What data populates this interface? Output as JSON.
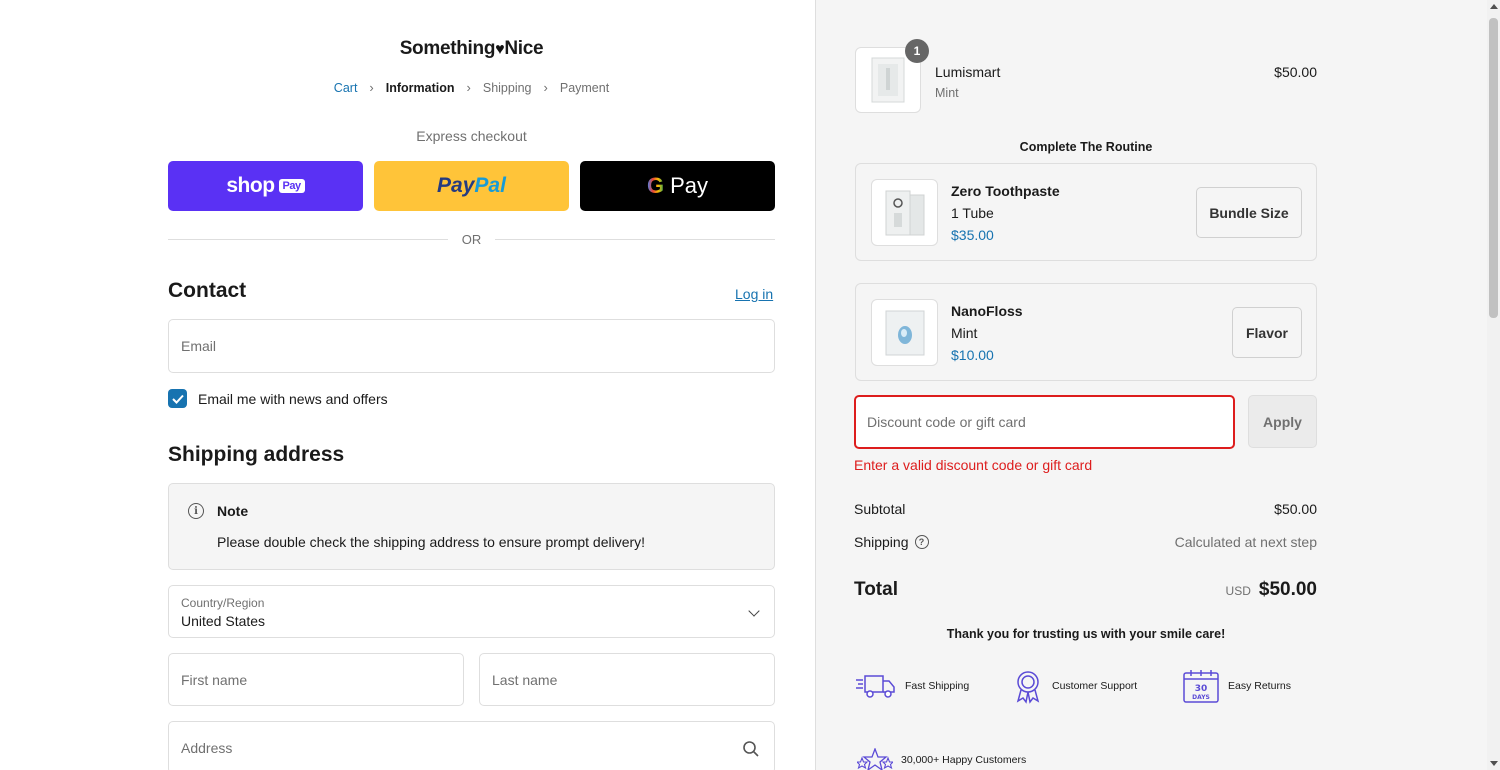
{
  "store": {
    "name_left": "Something",
    "name_right": "Nice"
  },
  "breadcrumb": {
    "cart": "Cart",
    "information": "Information",
    "shipping": "Shipping",
    "payment": "Payment"
  },
  "express": {
    "label": "Express checkout",
    "shop_pay": "shop",
    "shop_pay_tag": "Pay",
    "paypal_a": "Pay",
    "paypal_b": "Pal",
    "gpay_g": "G",
    "gpay_text": "Pay",
    "or": "OR"
  },
  "contact": {
    "title": "Contact",
    "login": "Log in",
    "email_placeholder": "Email",
    "newsletter_label": "Email me with news and offers",
    "newsletter_checked": true
  },
  "shipping_address": {
    "title": "Shipping address",
    "note_title": "Note",
    "note_text": "Please double check the shipping address to ensure prompt delivery!",
    "country_label": "Country/Region",
    "country_value": "United States",
    "first_name_placeholder": "First name",
    "last_name_placeholder": "Last name",
    "address_placeholder": "Address"
  },
  "cart_item": {
    "quantity": "1",
    "name": "Lumismart",
    "variant": "Mint",
    "price": "$50.00"
  },
  "routine": {
    "title": "Complete The Routine",
    "items": [
      {
        "name": "Zero Toothpaste",
        "variant": "1 Tube",
        "price": "$35.00",
        "button": "Bundle Size"
      },
      {
        "name": "NanoFloss",
        "variant": "Mint",
        "price": "$10.00",
        "button": "Flavor"
      }
    ]
  },
  "discount": {
    "placeholder": "Discount code or gift card",
    "apply": "Apply",
    "error": "Enter a valid discount code or gift card"
  },
  "summary": {
    "subtotal_label": "Subtotal",
    "subtotal_value": "$50.00",
    "shipping_label": "Shipping",
    "shipping_value": "Calculated at next step",
    "total_label": "Total",
    "currency": "USD",
    "total_value": "$50.00"
  },
  "trust": {
    "thanks": "Thank you for trusting us with your smile care!",
    "perks": [
      "Fast Shipping",
      "Customer Support",
      "Easy Returns",
      "30,000+ Happy Customers"
    ],
    "returns_badge_num": "30",
    "returns_badge_unit": "DAYS"
  },
  "colors": {
    "accent": "#1773b0",
    "error": "#dd1d1d",
    "shop_pay": "#5a31f4",
    "paypal": "#ffc439",
    "perk_icon": "#5b4bd6"
  }
}
